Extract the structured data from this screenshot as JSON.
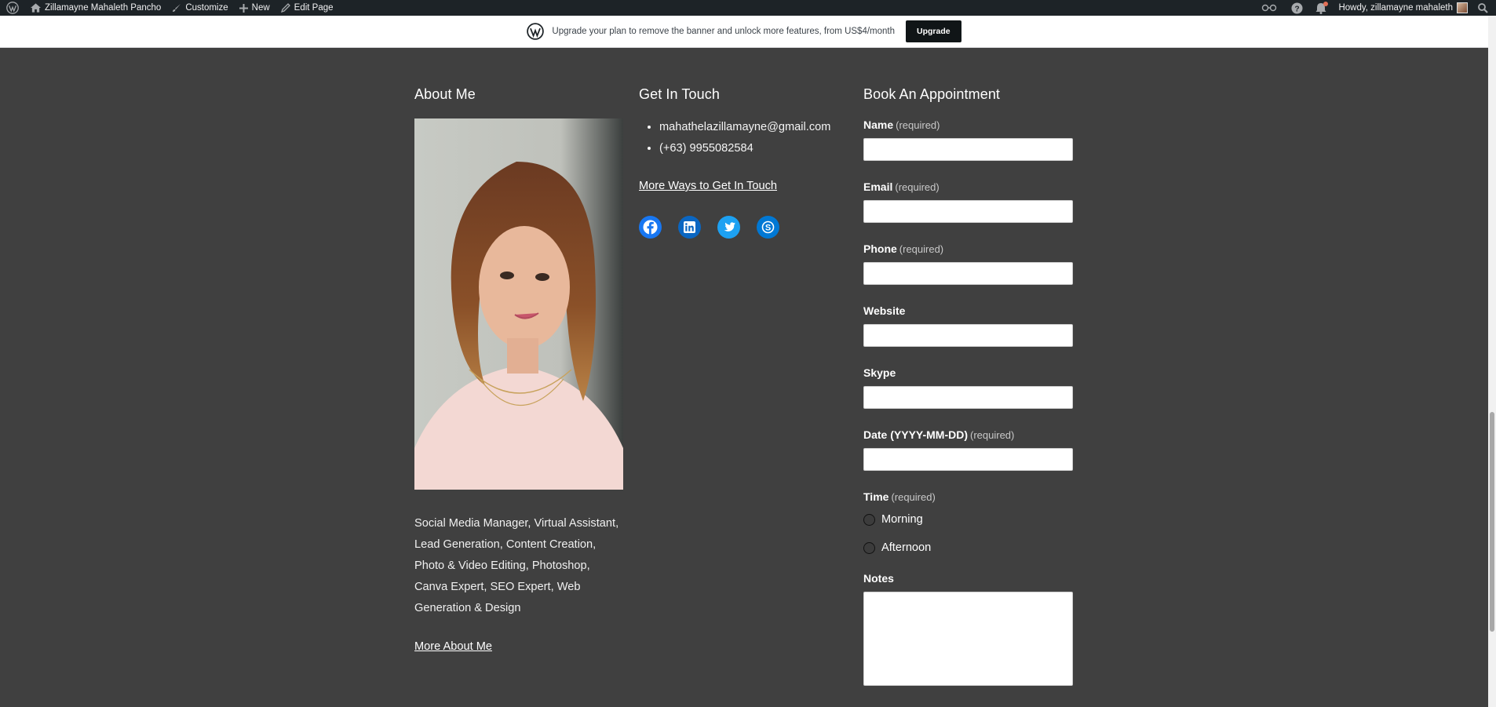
{
  "adminbar": {
    "site_name": "Zillamayne Mahaleth Pancho",
    "customize": "Customize",
    "new": "New",
    "edit_page": "Edit Page",
    "howdy": "Howdy, zillamayne mahaleth"
  },
  "banner": {
    "text": "Upgrade your plan to remove the banner and unlock more features, from US$4/month",
    "button": "Upgrade"
  },
  "about": {
    "heading": "About Me",
    "bio_lines": [
      "Social Media Manager, Virtual Assistant,",
      "Lead Generation, Content Creation,",
      "Photo & Video Editing, Photoshop,",
      "Canva Expert, SEO Expert, Web",
      "Generation & Design"
    ],
    "link": "More About Me"
  },
  "touch": {
    "heading": "Get In Touch",
    "email": "mahathelazillamayne@gmail.com",
    "phone": "(+63) 9955082584",
    "link": "More Ways to Get In Touch",
    "social_icons": [
      "facebook-icon",
      "linkedin-icon",
      "twitter-icon",
      "skype-icon"
    ],
    "colors": {
      "facebook": "#1877f2",
      "linkedin": "#0a66c2",
      "twitter": "#1da1f2",
      "skype": "#0078d4"
    }
  },
  "appointment": {
    "heading": "Book An Appointment",
    "required_text": "(required)",
    "fields": {
      "name": "Name",
      "email": "Email",
      "phone": "Phone",
      "website": "Website",
      "skype": "Skype",
      "date": "Date (YYYY-MM-DD)",
      "time": "Time",
      "notes": "Notes"
    },
    "time_options": [
      "Morning",
      "Afternoon"
    ]
  }
}
